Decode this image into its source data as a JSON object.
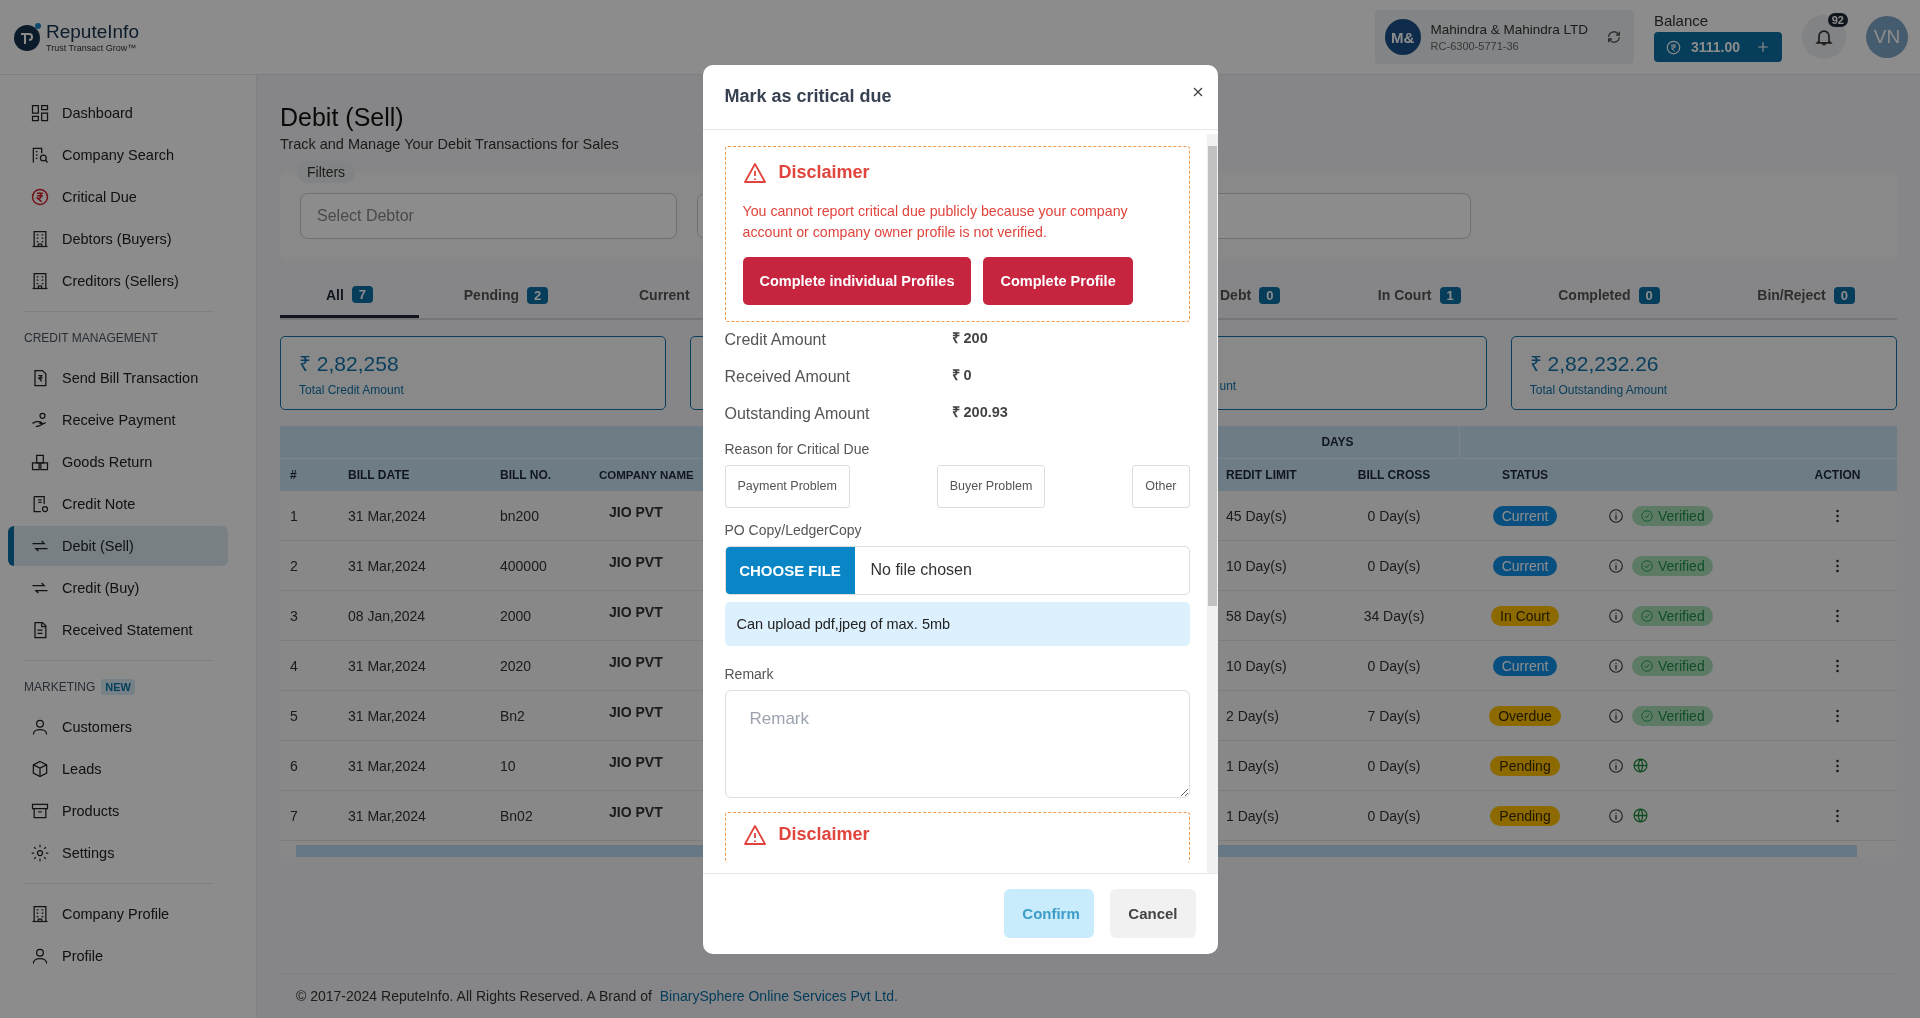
{
  "header": {
    "logo": {
      "name": "ReputeInfo",
      "tagline": "Trust Transact Grow™"
    },
    "company": {
      "initials": "M&",
      "name": "Mahindra & Mahindra LTD",
      "code": "RC-6300-5771-36"
    },
    "balance": {
      "label": "Balance",
      "amount": "3111.00"
    },
    "notifications": {
      "count": "92"
    },
    "user": {
      "initials": "VN"
    }
  },
  "sidebar": {
    "sections": [
      {
        "items": [
          {
            "label": "Dashboard",
            "selected": false
          },
          {
            "label": "Company Search",
            "selected": false
          },
          {
            "label": "Critical Due",
            "selected": false
          },
          {
            "label": "Debtors (Buyers)",
            "selected": false
          },
          {
            "label": "Creditors (Sellers)",
            "selected": false
          }
        ]
      },
      {
        "title": "CREDIT MANAGEMENT",
        "items": [
          {
            "label": "Send Bill Transaction",
            "selected": false
          },
          {
            "label": "Receive Payment",
            "selected": false
          },
          {
            "label": "Goods Return",
            "selected": false
          },
          {
            "label": "Credit Note",
            "selected": false
          },
          {
            "label": "Debit (Sell)",
            "selected": true
          },
          {
            "label": "Credit (Buy)",
            "selected": false
          },
          {
            "label": "Received Statement",
            "selected": false
          }
        ]
      },
      {
        "title": "MARKETING",
        "badge": "NEW",
        "items": [
          {
            "label": "Customers",
            "selected": false
          },
          {
            "label": "Leads",
            "selected": false
          },
          {
            "label": "Products",
            "selected": false
          },
          {
            "label": "Settings",
            "selected": false
          }
        ]
      },
      {
        "items": [
          {
            "label": "Company Profile",
            "selected": false
          },
          {
            "label": "Profile",
            "selected": false
          }
        ]
      }
    ]
  },
  "page": {
    "title": "Debit (Sell)",
    "subtitle": "Track and Manage Your Debit Transactions for Sales",
    "filters": {
      "label": "Filters",
      "fields": [
        {
          "placeholder": "Select Debtor"
        }
      ]
    },
    "tabs": [
      {
        "label": "All",
        "count": "7",
        "selected": true
      },
      {
        "label": "Pending",
        "count": "2",
        "selected": false
      },
      {
        "label": "Current",
        "selected": false
      },
      {
        "label": "Debt",
        "count": "0",
        "selected": false
      },
      {
        "label": "In Court",
        "count": "1",
        "selected": false
      },
      {
        "label": "Completed",
        "count": "0",
        "selected": false
      },
      {
        "label": "Bin/Reject",
        "count": "0",
        "selected": false
      }
    ],
    "cards": [
      {
        "amount": "₹ 2,82,258",
        "label": "Total Credit Amount"
      },
      {
        "label": "unt"
      },
      {
        "amount": "₹ 2,82,232.26",
        "label": "Total Outstanding Amount"
      }
    ],
    "table": {
      "group_header": "DAYS",
      "columns": [
        "#",
        "BILL DATE",
        "BILL NO.",
        "COMPANY NAME",
        "REDIT LIMIT",
        "BILL CROSS",
        "STATUS",
        "ACTION"
      ],
      "rows": [
        {
          "no": "1",
          "date": "31 Mar,2024",
          "bill": "bn200",
          "company": "JIO PVT",
          "credit_limit": "45 Day(s)",
          "bill_cross": "0 Day(s)",
          "status": {
            "label": "Current",
            "color": "#085080"
          },
          "verification": {
            "kind": "verified",
            "label": "Verified"
          }
        },
        {
          "no": "2",
          "date": "31 Mar,2024",
          "bill": "400000",
          "company": "JIO PVT",
          "credit_limit": "10 Day(s)",
          "bill_cross": "0 Day(s)",
          "status": {
            "label": "Current",
            "color": "#085080"
          },
          "verification": {
            "kind": "verified",
            "label": "Verified"
          }
        },
        {
          "no": "3",
          "date": "08 Jan,2024",
          "bill": "2000",
          "company": "JIO PVT",
          "credit_limit": "58 Day(s)",
          "bill_cross": "34 Day(s)",
          "status": {
            "label": "In Court",
            "color": "#8c6a00"
          },
          "verification": {
            "kind": "verified",
            "label": "Verified"
          }
        },
        {
          "no": "4",
          "date": "31 Mar,2024",
          "bill": "2020",
          "company": "JIO PVT",
          "credit_limit": "10 Day(s)",
          "bill_cross": "0 Day(s)",
          "status": {
            "label": "Current",
            "color": "#085080"
          },
          "verification": {
            "kind": "verified",
            "label": "Verified"
          }
        },
        {
          "no": "5",
          "date": "31 Mar,2024",
          "bill": "Bn2",
          "company": "JIO PVT",
          "credit_limit": "2 Day(s)",
          "bill_cross": "7 Day(s)",
          "status": {
            "label": "Overdue",
            "color": "#8c6a00"
          },
          "verification": {
            "kind": "verified",
            "label": "Verified"
          }
        },
        {
          "no": "6",
          "date": "31 Mar,2024",
          "bill": "10",
          "company": "JIO PVT",
          "credit_limit": "1 Day(s)",
          "bill_cross": "0 Day(s)",
          "status": {
            "label": "Pending",
            "color": "#8c6a00"
          },
          "verification": {
            "kind": "public"
          }
        },
        {
          "no": "7",
          "date": "31 Mar,2024",
          "bill": "Bn02",
          "company": "JIO PVT",
          "credit_limit": "1 Day(s)",
          "bill_cross": "0 Day(s)",
          "status": {
            "label": "Pending",
            "color": "#8c6a00"
          },
          "verification": {
            "kind": "public"
          }
        }
      ]
    },
    "footer": {
      "text": "© 2017-2024 ReputeInfo.  All Rights Reserved. A Brand of",
      "link": "BinarySphere Online Services Pvt Ltd."
    }
  },
  "modal": {
    "title": "Mark as critical due",
    "disclaimer": {
      "title": "Disclaimer",
      "text": "You cannot report critical due publicly because your company account or company owner profile is not verified.",
      "buttons": [
        "Complete individual Profiles",
        "Complete Profile"
      ]
    },
    "amounts": [
      {
        "label": "Credit Amount",
        "value": "₹ 200"
      },
      {
        "label": "Received Amount",
        "value": "₹ 0"
      },
      {
        "label": "Outstanding Amount",
        "value": "₹ 200.93"
      }
    ],
    "reason": {
      "label": "Reason for Critical Due",
      "options": [
        {
          "label": "Payment Problem",
          "selected": false
        },
        {
          "label": "Buyer Problem",
          "selected": false
        },
        {
          "label": "Other",
          "selected": false
        }
      ]
    },
    "upload": {
      "label": "PO Copy/LedgerCopy",
      "button": "CHOOSE FILE",
      "value": "No file chosen",
      "hint": "Can upload pdf,jpeg of max. 5mb"
    },
    "remark": {
      "label": "Remark",
      "placeholder": "Remark"
    },
    "second_disclaimer": {
      "title": "Disclaimer"
    },
    "buttons": [
      {
        "label": "Confirm",
        "kind": "primary",
        "disabled": true
      },
      {
        "label": "Cancel",
        "kind": "secondary",
        "disabled": false
      }
    ]
  }
}
